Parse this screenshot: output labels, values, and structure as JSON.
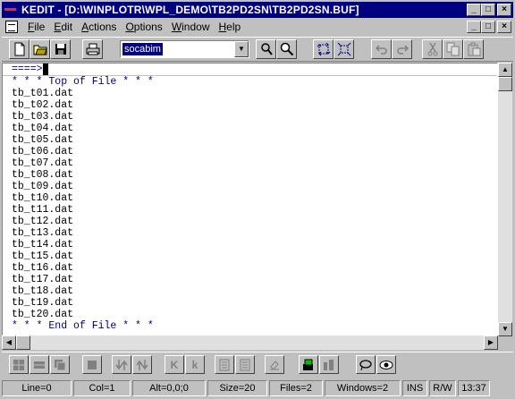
{
  "window": {
    "title": "KEDIT - [D:\\WINPLOTR\\WPL_DEMO\\TB2PD2SN\\TB2PD2SN.BUF]",
    "controls": {
      "minimize": "_",
      "maximize": "□",
      "close": "×"
    }
  },
  "menu": [
    {
      "ul": "F",
      "rest": "ile"
    },
    {
      "ul": "E",
      "rest": "dit"
    },
    {
      "ul": "A",
      "rest": "ctions"
    },
    {
      "ul": "O",
      "rest": "ptions"
    },
    {
      "ul": "W",
      "rest": "indow"
    },
    {
      "ul": "H",
      "rest": "elp"
    }
  ],
  "toolbar": {
    "command_value": "socabim",
    "icons": [
      "new-file-icon",
      "open-folder-icon",
      "save-icon",
      "print-icon",
      "find-icon",
      "zoom-icon",
      "select-block-icon",
      "expand-block-icon",
      "undo-icon",
      "redo-icon",
      "cut-icon",
      "copy-icon",
      "paste-icon"
    ]
  },
  "editor": {
    "command_prompt": "====>",
    "top_marker": "* * * Top of File * * *",
    "bottom_marker": "* * * End of File * * *",
    "lines": [
      "tb_t01.dat",
      "tb_t02.dat",
      "tb_t03.dat",
      "tb_t04.dat",
      "tb_t05.dat",
      "tb_t06.dat",
      "tb_t07.dat",
      "tb_t08.dat",
      "tb_t09.dat",
      "tb_t10.dat",
      "tb_t11.dat",
      "tb_t12.dat",
      "tb_t13.dat",
      "tb_t14.dat",
      "tb_t15.dat",
      "tb_t16.dat",
      "tb_t17.dat",
      "tb_t18.dat",
      "tb_t19.dat",
      "tb_t20.dat"
    ]
  },
  "bottom_toolbar": {
    "k_upper": "K",
    "k_lower": "k"
  },
  "status": {
    "line": "Line=0",
    "col": "Col=1",
    "alt": "Alt=0,0;0",
    "size": "Size=20",
    "files": "Files=2",
    "windows": "Windows=2",
    "mode": "INS",
    "access": "R/W",
    "time": "13:37"
  }
}
